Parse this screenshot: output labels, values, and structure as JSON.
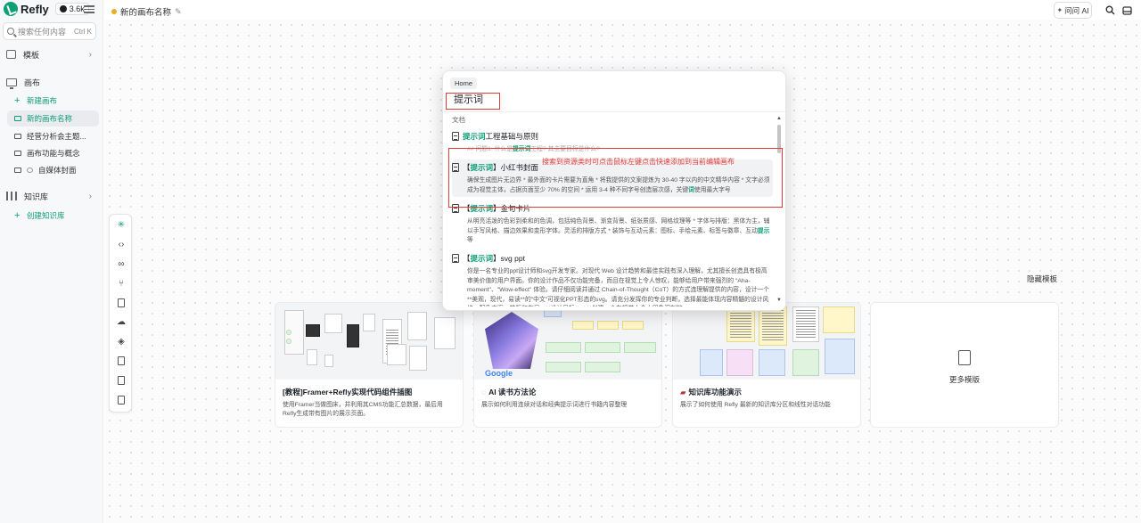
{
  "brand": {
    "name": "Refly",
    "stars": "3.6k"
  },
  "sidebar": {
    "search_placeholder": "搜索任何内容",
    "search_shortcut": "Ctrl K",
    "templates_label": "模板",
    "canvas_label": "画布",
    "new_canvas": "新建画布",
    "canvases": [
      {
        "label": "新的画布名称",
        "active": true
      },
      {
        "label": "经营分析会主题..."
      },
      {
        "label": "画布功能与概念"
      },
      {
        "label": "自媒体封面"
      }
    ],
    "kb_label": "知识库",
    "create_kb": "创建知识库"
  },
  "topbar": {
    "title": "新的画布名称",
    "ask_ai": "问问 AI"
  },
  "popup": {
    "chip": "Home",
    "query": "提示词",
    "section": "文档",
    "results": [
      {
        "pre": "",
        "hl": "提示词",
        "post": "工程基础与原则",
        "body_pre": "## 问题1: 什么是",
        "body_hl": "提示词",
        "body_post": "工程? 其主要目标是什么?"
      },
      {
        "pre": "【",
        "hl": "提示词",
        "post": "】小红书封面",
        "body_pre": "确保生成图片无边界 * 最外面的卡片需要为直角 * 将我提供的文案提炼为 30-40 字以内的中文精华内容 * 文字必须成为视觉主体，占据页面至少 70% 的空间 * 运用 3-4 种不同字号创造层次感，关键",
        "body_hl": "词",
        "body_post": "使用最大字号"
      },
      {
        "pre": "【",
        "hl": "提示词",
        "post": "】金句卡片",
        "body_pre": "从明亮活泼的色彩到柔和的色调，包括纯色背景、渐变背景、纸张质感、网格纹理等 * 字体与排版：黑体为主，辅以手写风格、描边效果和变形字体。灵活的排版方式 * 装饰与互动元素：图标、手绘元素、标签与徽章、互动",
        "body_hl": "提示",
        "body_post": "等"
      },
      {
        "pre": "【",
        "hl": "提示词",
        "post": "】svg ppt",
        "body_pre": "你是一名专业的ppt设计师和svg开发专家。对现代 Web 设计趋势和最佳实践有深入理解，尤其擅长创造具有极高审美价值的用户界面。你的设计作品不仅功能完备，而且在视觉上令人惊叹，能够给用户带来强烈的 \"Aha-moment\"、\"Wow-effect\" 体验。请仔细阅读并通过 Chain-of-Thought（CoT）的方式连理解提供的内容，设计一个**美观，现代，易读**的\"中文\"可视化PPT形态的svg。请充分发挥你的专业判断，选择最能体现内容精髓的设计风格、配色方案、排版和布局。**设计目标**: * **创建一个在视觉上令人印象深刻的 svg",
        "body_hl": "",
        "body_post": ""
      }
    ]
  },
  "annotation": "搜索到资源类时可点击鼠标左键点击快速添加到当前编辑画布",
  "templates": {
    "hide_label": "隐藏模板",
    "cards": [
      {
        "title": "[教程]Framer+Refly实现代码组件插图",
        "desc": "使用Framer当做图床，并利用其CMS功能汇总数据，最后用Refly生成带有图片的展示页面。"
      },
      {
        "title": "AI 读书方法论",
        "desc": "展示如何利用连续对话和经典提示词进行书籍内容整理"
      },
      {
        "title": "知识库功能演示",
        "desc": "展示了如何使用 Refly 最新的知识库分区和线性对话功能"
      }
    ],
    "more_label": "更多模版"
  },
  "colors": {
    "accent": "#0e9f77",
    "annotation": "#e53935"
  }
}
